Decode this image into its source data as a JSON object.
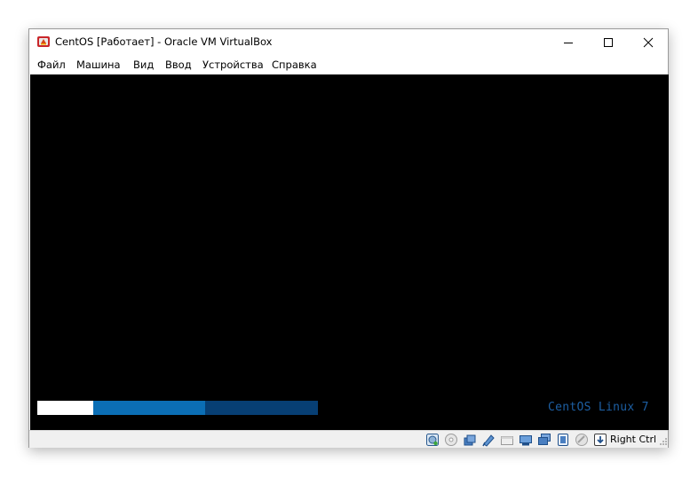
{
  "window": {
    "title": "CentOS [Работает] - Oracle VM VirtualBox",
    "app_icon": "virtualbox-icon",
    "controls": [
      "minimize-icon",
      "maximize-icon",
      "close-icon"
    ]
  },
  "menu": {
    "items": [
      {
        "label": "Файл"
      },
      {
        "label": "Машина"
      },
      {
        "label": "Вид"
      },
      {
        "label": "Ввод"
      },
      {
        "label": "Устройства"
      },
      {
        "label": "Справка"
      }
    ]
  },
  "guest_screen": {
    "background": "#000000",
    "boot_brand": "CentOS Linux 7",
    "brand_color": "#1d5fa3",
    "progress_segments": [
      {
        "color": "#ffffff"
      },
      {
        "color": "#0b6eb5"
      },
      {
        "color": "#073f74"
      }
    ]
  },
  "statusbar": {
    "icons": [
      "hard-disk-icon",
      "optical-drive-icon",
      "audio-icon",
      "network-icon",
      "usb-icon",
      "shared-folders-icon",
      "display-icon",
      "video-capture-icon",
      "cpu-icon",
      "mouse-integration-icon",
      "keyboard-capture-icon"
    ],
    "host_key": "Right Ctrl"
  }
}
